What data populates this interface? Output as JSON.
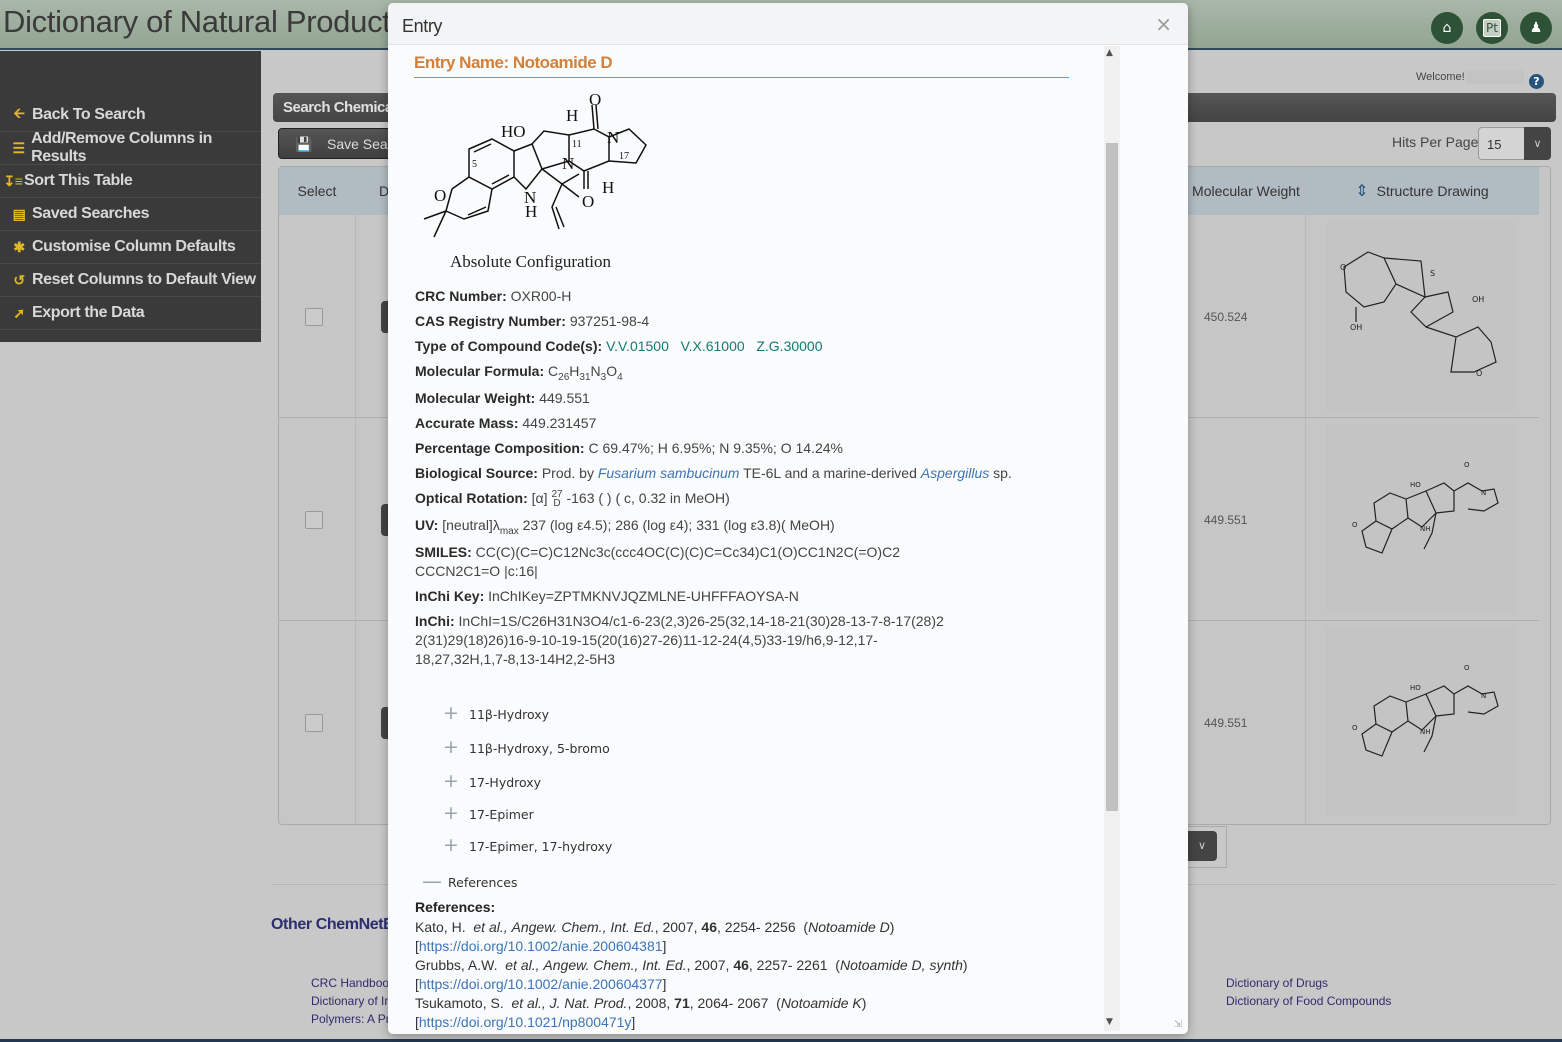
{
  "header": {
    "app_title": "Dictionary of Natural Products",
    "buttons": [
      {
        "name": "home",
        "icon": "home-icon"
      },
      {
        "name": "pt",
        "label": "Pt"
      },
      {
        "name": "user",
        "icon": "user-icon"
      }
    ]
  },
  "sidebar": {
    "items": [
      {
        "label": "Back To Search",
        "icon": "arrow-left-icon"
      },
      {
        "label": "Add/Remove Columns in Results",
        "icon": "list-icon"
      },
      {
        "label": "Sort This Table",
        "icon": "sort-icon"
      },
      {
        "label": "Saved Searches",
        "icon": "saved-list-icon"
      },
      {
        "label": "Customise Column Defaults",
        "icon": "asterisk-icon"
      },
      {
        "label": "Reset Columns to Default View",
        "icon": "reset-icon"
      },
      {
        "label": "Export the Data",
        "icon": "export-icon"
      }
    ]
  },
  "main": {
    "welcome": "Welcome!",
    "search_bar_label": "Search Chemicals",
    "save_button_label": "Save Search",
    "hits_per_page_label": "Hits Per Page:",
    "hits_per_page_value": "15",
    "table": {
      "columns": [
        "Select",
        "D",
        "Molecular Weight",
        "Structure Drawing"
      ],
      "rows": [
        {
          "molecular_weight": "450.524"
        },
        {
          "molecular_weight": "449.551"
        },
        {
          "molecular_weight": "449.551"
        }
      ]
    },
    "footer": {
      "title": "Other ChemNetBase",
      "links_left": [
        "CRC Handbook",
        "Dictionary of In",
        "Polymers: A Pro"
      ],
      "links_right": [
        "Dictionary of Drugs",
        "Dictionary of Food Compounds"
      ]
    }
  },
  "modal": {
    "title": "Entry",
    "entry_name": "Entry Name: Notoamide D",
    "structure_caption": "Absolute Configuration",
    "fields": {
      "crc_number": {
        "label": "CRC Number:",
        "value": "OXR00-H"
      },
      "cas": {
        "label": "CAS Registry Number:",
        "value": "937251-98-4"
      },
      "type_codes": {
        "label": "Type of Compound Code(s):",
        "values": [
          "V.V.01500",
          "V.X.61000",
          "Z.G.30000"
        ]
      },
      "formula": {
        "label": "Molecular Formula:",
        "value": "C26H31N3O4"
      },
      "mol_weight": {
        "label": "Molecular Weight:",
        "value": "449.551"
      },
      "accurate_mass": {
        "label": "Accurate Mass:",
        "value": "449.231457"
      },
      "composition": {
        "label": "Percentage Composition:",
        "value": "C 69.47%; H 6.95%; N 9.35%; O 14.24%"
      },
      "bio_source": {
        "label": "Biological Source:",
        "prefix": "Prod. by",
        "organism1": "Fusarium sambucinum",
        "middle": "TE-6L and a marine-derived",
        "organism2": "Aspergillus",
        "suffix": "sp."
      },
      "optical_rotation": {
        "label": "Optical Rotation:",
        "alpha": "[α]",
        "temp": "27",
        "line": "D",
        "value": "-163  ( )  ( c, 0.32 in MeOH)"
      },
      "uv": {
        "label": "UV:",
        "prefix": "[neutral]λ",
        "sub": "max",
        "value": " 237 (log ε4.5); 286 (log ε4); 331 (log ε3.8)( MeOH)"
      },
      "smiles": {
        "label": "SMILES:",
        "line1": "CC(C)(C=C)C12Nc3c(ccc4OC(C)(C)C=Cc34)C1(O)CC1N2C(=O)C2",
        "line2": "CCCN2C1=O |c:16|"
      },
      "inchi_key": {
        "label": "InChi Key:",
        "value": "InChIKey=ZPTMKNVJQZMLNE-UHFFFAOYSA-N"
      },
      "inchi": {
        "label": "InChi:",
        "line1": "InChI=1S/C26H31N3O4/c1-6-23(2,3)26-25(32,14-18-21(30)28-13-7-8-17(28)2",
        "line2": "2(31)29(18)26)16-9-10-19-15(20(16)27-26)11-12-24(4,5)33-19/h6,9-12,17-",
        "line3": "18,27,32H,1,7-8,13-14H2,2-5H3"
      }
    },
    "variants": [
      "11β-Hydroxy",
      "11β-Hydroxy, 5-bromo",
      "17-Hydroxy",
      "17-Epimer",
      "17-Epimer, 17-hydroxy"
    ],
    "references_toggle": "References",
    "references_heading": "References:",
    "references": [
      {
        "authors": "Kato, H.",
        "etal": "et al.,",
        "journal": "Angew. Chem., Int. Ed.",
        "year": "2007,",
        "volume": "46",
        "pages": ", 2254- 2256",
        "note": "Notoamide D",
        "doi": "https://doi.org/10.1002/anie.200604381"
      },
      {
        "authors": "Grubbs, A.W.",
        "etal": "et al.,",
        "journal": "Angew. Chem., Int. Ed.",
        "year": "2007,",
        "volume": "46",
        "pages": ", 2257- 2261",
        "note": "Notoamide D, synth",
        "doi": "https://doi.org/10.1002/anie.200604377"
      },
      {
        "authors": "Tsukamoto, S.",
        "etal": "et al.,",
        "journal": "J. Nat. Prod.",
        "year": "2008,",
        "volume": "71",
        "pages": ", 2064- 2067",
        "note": "Notoamide K",
        "doi": "https://doi.org/10.1021/np800471y"
      }
    ]
  }
}
